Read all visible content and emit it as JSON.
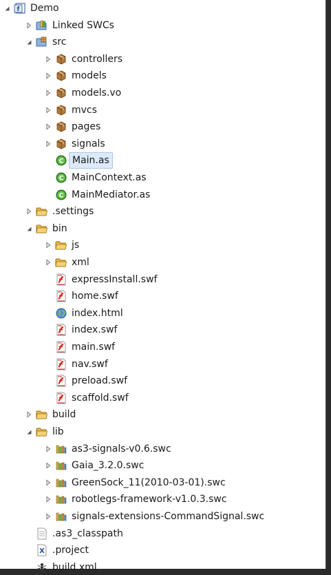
{
  "tree": [
    {
      "label": "Demo",
      "depth": 0,
      "arrow": "expanded",
      "icon": "flex-project-icon"
    },
    {
      "label": "Linked SWCs",
      "depth": 1,
      "arrow": "collapsed",
      "icon": "library-folder-icon"
    },
    {
      "label": "src",
      "depth": 1,
      "arrow": "expanded",
      "icon": "source-folder-icon"
    },
    {
      "label": "controllers",
      "depth": 2,
      "arrow": "collapsed",
      "icon": "package-icon"
    },
    {
      "label": "models",
      "depth": 2,
      "arrow": "collapsed",
      "icon": "package-icon"
    },
    {
      "label": "models.vo",
      "depth": 2,
      "arrow": "collapsed",
      "icon": "package-icon"
    },
    {
      "label": "mvcs",
      "depth": 2,
      "arrow": "collapsed",
      "icon": "package-icon"
    },
    {
      "label": "pages",
      "depth": 2,
      "arrow": "collapsed",
      "icon": "package-icon"
    },
    {
      "label": "signals",
      "depth": 2,
      "arrow": "collapsed",
      "icon": "package-icon"
    },
    {
      "label": "Main.as",
      "depth": 2,
      "arrow": "none",
      "icon": "class-file-icon",
      "selected": true
    },
    {
      "label": "MainContext.as",
      "depth": 2,
      "arrow": "none",
      "icon": "class-file-icon"
    },
    {
      "label": "MainMediator.as",
      "depth": 2,
      "arrow": "none",
      "icon": "class-file-icon"
    },
    {
      "label": ".settings",
      "depth": 1,
      "arrow": "collapsed",
      "icon": "folder-icon"
    },
    {
      "label": "bin",
      "depth": 1,
      "arrow": "expanded",
      "icon": "folder-icon"
    },
    {
      "label": "js",
      "depth": 2,
      "arrow": "collapsed",
      "icon": "folder-icon"
    },
    {
      "label": "xml",
      "depth": 2,
      "arrow": "collapsed",
      "icon": "folder-icon"
    },
    {
      "label": "expressInstall.swf",
      "depth": 2,
      "arrow": "none",
      "icon": "swf-file-icon"
    },
    {
      "label": "home.swf",
      "depth": 2,
      "arrow": "none",
      "icon": "swf-file-icon"
    },
    {
      "label": "index.html",
      "depth": 2,
      "arrow": "none",
      "icon": "html-file-icon"
    },
    {
      "label": "index.swf",
      "depth": 2,
      "arrow": "none",
      "icon": "swf-file-icon"
    },
    {
      "label": "main.swf",
      "depth": 2,
      "arrow": "none",
      "icon": "swf-file-icon"
    },
    {
      "label": "nav.swf",
      "depth": 2,
      "arrow": "none",
      "icon": "swf-file-icon"
    },
    {
      "label": "preload.swf",
      "depth": 2,
      "arrow": "none",
      "icon": "swf-file-icon"
    },
    {
      "label": "scaffold.swf",
      "depth": 2,
      "arrow": "none",
      "icon": "swf-file-icon"
    },
    {
      "label": "build",
      "depth": 1,
      "arrow": "collapsed",
      "icon": "folder-icon"
    },
    {
      "label": "lib",
      "depth": 1,
      "arrow": "expanded",
      "icon": "folder-icon"
    },
    {
      "label": "as3-signals-v0.6.swc",
      "depth": 2,
      "arrow": "collapsed",
      "icon": "swc-library-icon"
    },
    {
      "label": "Gaia_3.2.0.swc",
      "depth": 2,
      "arrow": "collapsed",
      "icon": "swc-library-icon"
    },
    {
      "label": "GreenSock_11(2010-03-01).swc",
      "depth": 2,
      "arrow": "collapsed",
      "icon": "swc-library-icon"
    },
    {
      "label": "robotlegs-framework-v1.0.3.swc",
      "depth": 2,
      "arrow": "collapsed",
      "icon": "swc-library-icon"
    },
    {
      "label": "signals-extensions-CommandSignal.swc",
      "depth": 2,
      "arrow": "collapsed",
      "icon": "swc-library-icon"
    },
    {
      "label": ".as3_classpath",
      "depth": 1,
      "arrow": "none",
      "icon": "text-file-icon"
    },
    {
      "label": ".project",
      "depth": 1,
      "arrow": "none",
      "icon": "xml-file-icon"
    },
    {
      "label": "build.xml",
      "depth": 1,
      "arrow": "none",
      "icon": "ant-file-icon"
    }
  ],
  "colors": {
    "background": "#ffffff",
    "selection": "#dceaf9",
    "folder": "#e8b94a",
    "package": "#b27a3d",
    "class_green": "#3f9d2f",
    "swf_red": "#d42a1f",
    "library_bars": "#d8b032"
  }
}
